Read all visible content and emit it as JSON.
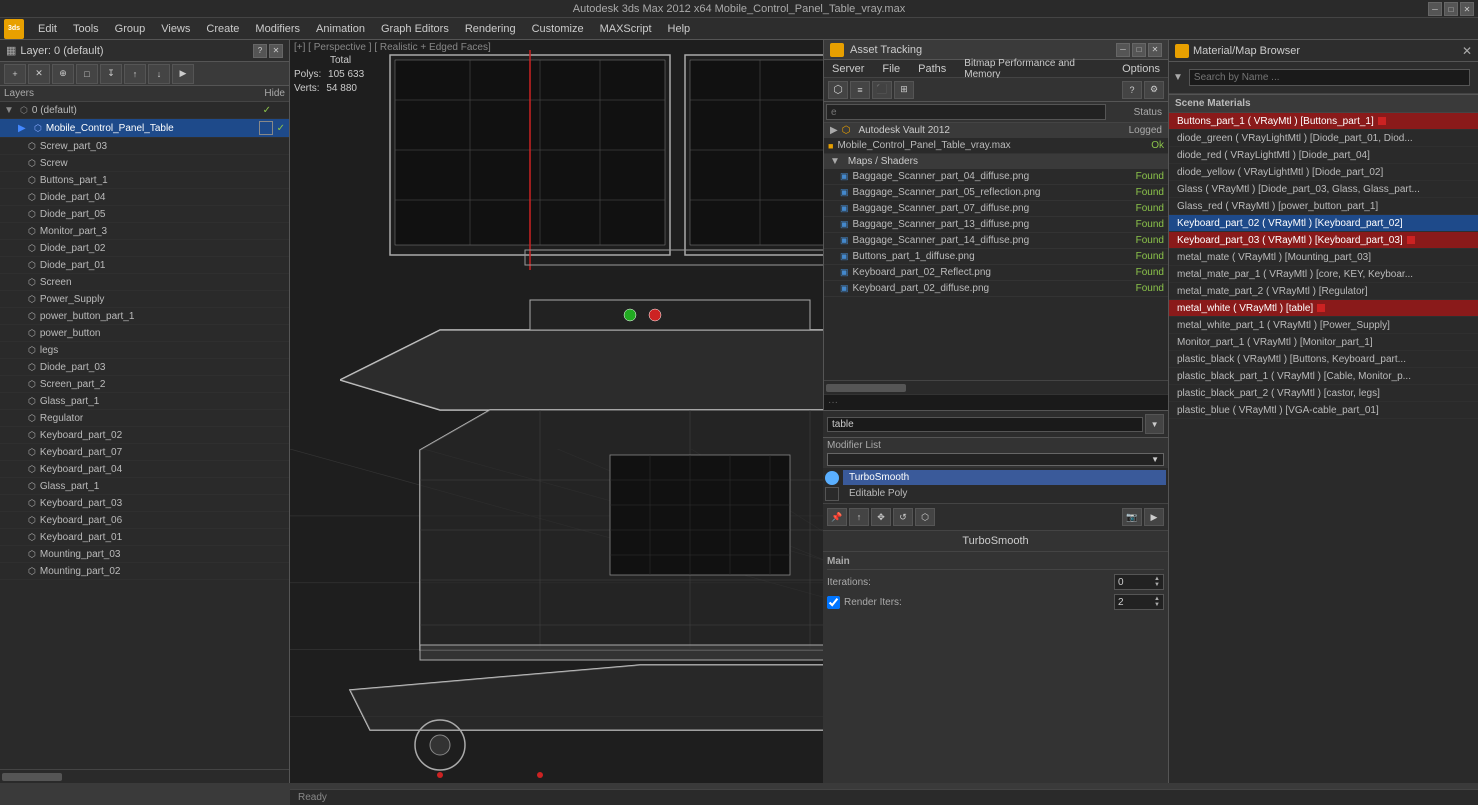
{
  "app": {
    "title": "Autodesk 3ds Max 2012 x64    Mobile_Control_Panel_Table_vray.max",
    "icon_label": "3ds"
  },
  "main_menu": {
    "items": [
      "Edit",
      "Tools",
      "Group",
      "Views",
      "Create",
      "Modifiers",
      "Animation",
      "Graph Editors",
      "Rendering",
      "Customize",
      "MAXScript",
      "Help"
    ]
  },
  "viewport": {
    "label": "[+] [ Perspective ] [ Realistic + Edged Faces]",
    "stats": {
      "polys_label": "Polys:",
      "polys_value": "105 633",
      "verts_label": "Verts:",
      "verts_value": "54 880",
      "total_label": "Total"
    }
  },
  "layers_panel": {
    "title": "Layer: 0 (default)",
    "header_label": "Layers",
    "hide_label": "Hide",
    "items": [
      {
        "name": "0 (default)",
        "indent": 0,
        "checked": true,
        "selected": false
      },
      {
        "name": "Mobile_Control_Panel_Table",
        "indent": 1,
        "checked": false,
        "selected": true
      },
      {
        "name": "Screw_part_03",
        "indent": 2,
        "checked": false,
        "selected": false
      },
      {
        "name": "Screw",
        "indent": 2,
        "checked": false,
        "selected": false
      },
      {
        "name": "Buttons_part_1",
        "indent": 2,
        "checked": false,
        "selected": false
      },
      {
        "name": "Diode_part_04",
        "indent": 2,
        "checked": false,
        "selected": false
      },
      {
        "name": "Diode_part_05",
        "indent": 2,
        "checked": false,
        "selected": false
      },
      {
        "name": "Monitor_part_3",
        "indent": 2,
        "checked": false,
        "selected": false
      },
      {
        "name": "Diode_part_02",
        "indent": 2,
        "checked": false,
        "selected": false
      },
      {
        "name": "Diode_part_01",
        "indent": 2,
        "checked": false,
        "selected": false
      },
      {
        "name": "Screen",
        "indent": 2,
        "checked": false,
        "selected": false
      },
      {
        "name": "Power_Supply",
        "indent": 2,
        "checked": false,
        "selected": false
      },
      {
        "name": "power_button_part_1",
        "indent": 2,
        "checked": false,
        "selected": false
      },
      {
        "name": "power_button",
        "indent": 2,
        "checked": false,
        "selected": false
      },
      {
        "name": "legs",
        "indent": 2,
        "checked": false,
        "selected": false
      },
      {
        "name": "Diode_part_03",
        "indent": 2,
        "checked": false,
        "selected": false
      },
      {
        "name": "Screen_part_2",
        "indent": 2,
        "checked": false,
        "selected": false
      },
      {
        "name": "Glass_part_1",
        "indent": 2,
        "checked": false,
        "selected": false
      },
      {
        "name": "Regulator",
        "indent": 2,
        "checked": false,
        "selected": false
      },
      {
        "name": "Keyboard_part_02",
        "indent": 2,
        "checked": false,
        "selected": false
      },
      {
        "name": "Keyboard_part_07",
        "indent": 2,
        "checked": false,
        "selected": false
      },
      {
        "name": "Keyboard_part_04",
        "indent": 2,
        "checked": false,
        "selected": false
      },
      {
        "name": "Glass_part_1",
        "indent": 2,
        "checked": false,
        "selected": false
      },
      {
        "name": "Keyboard_part_03",
        "indent": 2,
        "checked": false,
        "selected": false
      },
      {
        "name": "Keyboard_part_06",
        "indent": 2,
        "checked": false,
        "selected": false
      },
      {
        "name": "Keyboard_part_01",
        "indent": 2,
        "checked": false,
        "selected": false
      },
      {
        "name": "Mounting_part_03",
        "indent": 2,
        "checked": false,
        "selected": false
      },
      {
        "name": "Mounting_part_02",
        "indent": 2,
        "checked": false,
        "selected": false
      }
    ]
  },
  "asset_tracking": {
    "title": "Asset Tracking",
    "menu_items": [
      "Server",
      "File",
      "Paths",
      "Bitmap Performance and Memory",
      "Options"
    ],
    "search_placeholder": "e",
    "status_column": "Status",
    "groups": [
      {
        "name": "Autodesk Vault 2012",
        "status": "Logged"
      }
    ],
    "files": [
      {
        "name": "Mobile_Control_Panel_Table_vray.max",
        "status": "Ok",
        "type": "max"
      },
      {
        "name": "Maps / Shaders",
        "status": "",
        "type": "group"
      },
      {
        "name": "Baggage_Scanner_part_04_diffuse.png",
        "status": "Found",
        "type": "img"
      },
      {
        "name": "Baggage_Scanner_part_05_reflection.png",
        "status": "Found",
        "type": "img"
      },
      {
        "name": "Baggage_Scanner_part_07_diffuse.png",
        "status": "Found",
        "type": "img"
      },
      {
        "name": "Baggage_Scanner_part_13_diffuse.png",
        "status": "Found",
        "type": "img"
      },
      {
        "name": "Baggage_Scanner_part_14_diffuse.png",
        "status": "Found",
        "type": "img"
      },
      {
        "name": "Buttons_part_1_diffuse.png",
        "status": "Found",
        "type": "img"
      },
      {
        "name": "Keyboard_part_02_Reflect.png",
        "status": "Found",
        "type": "img"
      },
      {
        "name": "Keyboard_part_02_diffuse.png",
        "status": "Found",
        "type": "img"
      }
    ]
  },
  "modifier_panel": {
    "search_placeholder": "table",
    "modifier_list_label": "Modifier List",
    "modifiers": [
      {
        "name": "TurboSmooth",
        "selected": true
      },
      {
        "name": "Editable Poly",
        "selected": false
      }
    ],
    "properties": {
      "section": "Main",
      "iterations_label": "Iterations:",
      "iterations_value": "0",
      "render_iters_label": "Render Iters:",
      "render_iters_value": "2",
      "render_iters_checked": true
    }
  },
  "material_browser": {
    "title": "Material/Map Browser",
    "search_placeholder": "Search by Name ...",
    "section_label": "Scene Materials",
    "materials": [
      {
        "name": "Buttons_part_1 ( VRayMtl ) [Buttons_part_1]",
        "selected": "red"
      },
      {
        "name": "diode_green ( VRayLightMtl ) [Diode_part_01, Diod...",
        "selected": false
      },
      {
        "name": "diode_red ( VRayLightMtl ) [Diode_part_04]",
        "selected": false
      },
      {
        "name": "diode_yellow ( VRayLightMtl ) [Diode_part_02]",
        "selected": false
      },
      {
        "name": "Glass ( VRayMtl ) [Diode_part_03, Glass, Glass_part...",
        "selected": false
      },
      {
        "name": "Glass_red ( VRayMtl ) [power_button_part_1]",
        "selected": false
      },
      {
        "name": "Keyboard_part_02 ( VRayMtl ) [Keyboard_part_02]",
        "selected": "blue"
      },
      {
        "name": "Keyboard_part_03 ( VRayMtl ) [Keyboard_part_03]",
        "selected": "red"
      },
      {
        "name": "metal_mate ( VRayMtl ) [Mounting_part_03]",
        "selected": false
      },
      {
        "name": "metal_mate_par_1 ( VRayMtl ) [core, KEY, Keyboar...",
        "selected": false
      },
      {
        "name": "metal_mate_part_2 ( VRayMtl ) [Regulator]",
        "selected": false
      },
      {
        "name": "metal_white ( VRayMtl ) [table]",
        "selected": "red"
      },
      {
        "name": "metal_white_part_1 ( VRayMtl ) [Power_Supply]",
        "selected": false
      },
      {
        "name": "Monitor_part_1 ( VRayMtl ) [Monitor_part_1]",
        "selected": false
      },
      {
        "name": "plastic_black ( VRayMtl ) [Buttons, Keyboard_part...",
        "selected": false
      },
      {
        "name": "plastic_black_part_1 ( VRayMtl ) [Cable, Monitor_p...",
        "selected": false
      },
      {
        "name": "plastic_black_part_2 ( VRayMtl ) [castor, legs]",
        "selected": false
      },
      {
        "name": "plastic_blue ( VRayMtl ) [VGA-cable_part_01]",
        "selected": false
      }
    ]
  },
  "icons": {
    "close": "✕",
    "minimize": "─",
    "maximize": "□",
    "expand": "▶",
    "collapse": "▼",
    "check": "✓",
    "folder": "📁",
    "file": "📄",
    "image": "🖼",
    "arrow_down": "▼",
    "arrow_up": "▲",
    "arrow_right": "▶",
    "lock": "🔒",
    "eye": "👁",
    "gear": "⚙",
    "search": "🔍",
    "dot": "●"
  },
  "colors": {
    "accent_blue": "#4a7bc4",
    "accent_red": "#cc2222",
    "found_green": "#8bc34a",
    "bg_dark": "#1a1a1a",
    "bg_panel": "#2d2d2d",
    "bg_mid": "#3a3a3a",
    "border": "#555555",
    "text_main": "#cccccc",
    "text_dim": "#888888",
    "selected_row": "#1e4a8a"
  }
}
